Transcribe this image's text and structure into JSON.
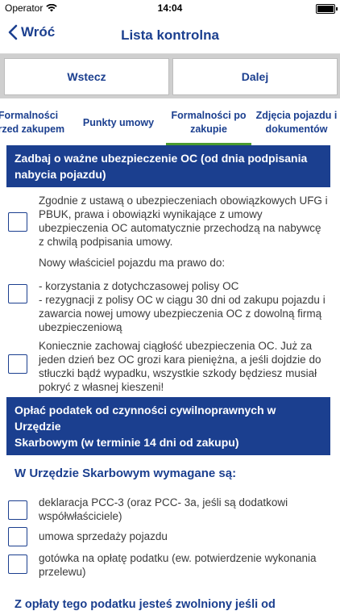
{
  "status_bar": {
    "carrier": "Operator",
    "time": "14:04"
  },
  "nav": {
    "back_label": "Wróć",
    "title": "Lista kontrolna"
  },
  "pager": {
    "prev_label": "Wstecz",
    "next_label": "Dalej"
  },
  "tabs": [
    {
      "line1": "Formalności",
      "line2": "przed zakupem"
    },
    {
      "line1": "Punkty umowy",
      "line2": ""
    },
    {
      "line1": "Formalności po",
      "line2": "zakupie"
    },
    {
      "line1": "Zdjęcia pojazdu i",
      "line2": "dokumentów"
    }
  ],
  "section1": {
    "header_line1": "Zadbaj o ważne ubezpieczenie OC (od dnia podpisania",
    "header_line2": "nabycia pojazdu)",
    "item1": [
      "Zgodnie z ustawą o ubezpieczeniach obowiązkowych UFG i",
      "PBUK,  prawa i obowiązki wynikające z umowy",
      "ubezpieczenia OC automatycznie przechodzą na nabywcę",
      "z chwilą podpisania umowy."
    ],
    "intro": "Nowy właściciel pojazdu ma prawo do:",
    "item2": [
      "- korzystania z dotychczasowej polisy OC",
      "- rezygnacji z polisy OC w ciągu 30 dni od zakupu pojazdu i",
      "zawarcia nowej umowy ubezpieczenia OC z dowolną firmą",
      "ubezpieczeniową"
    ],
    "item3": [
      "Koniecznie zachowaj ciągłość ubezpieczenia OC. Już za",
      "jeden dzień bez OC grozi kara pieniężna, a jeśli dojdzie do",
      "stłuczki bądź wypadku, wszystkie szkody będziesz musiał",
      "pokryć z własnej kieszeni!"
    ]
  },
  "section2": {
    "header_line1": "Opłać podatek od czynności cywilnoprawnych w Urzędzie",
    "header_line2": "Skarbowym (w terminie 14 dni od zakupu)",
    "subheading": "W Urzędzie Skarbowym wymagane są:",
    "items": [
      [
        "deklaracja PCC-3 (oraz PCC- 3a, jeśli są dodatkowi",
        "współwłaściciele)"
      ],
      [
        "umowa sprzedaży pojazdu"
      ],
      [
        "gotówka na opłatę podatku (ew. potwierdzenie wykonania",
        "przelewu)"
      ]
    ],
    "cutoff_text": "Z opłaty tego podatku jesteś zwolniony jeśli od"
  }
}
